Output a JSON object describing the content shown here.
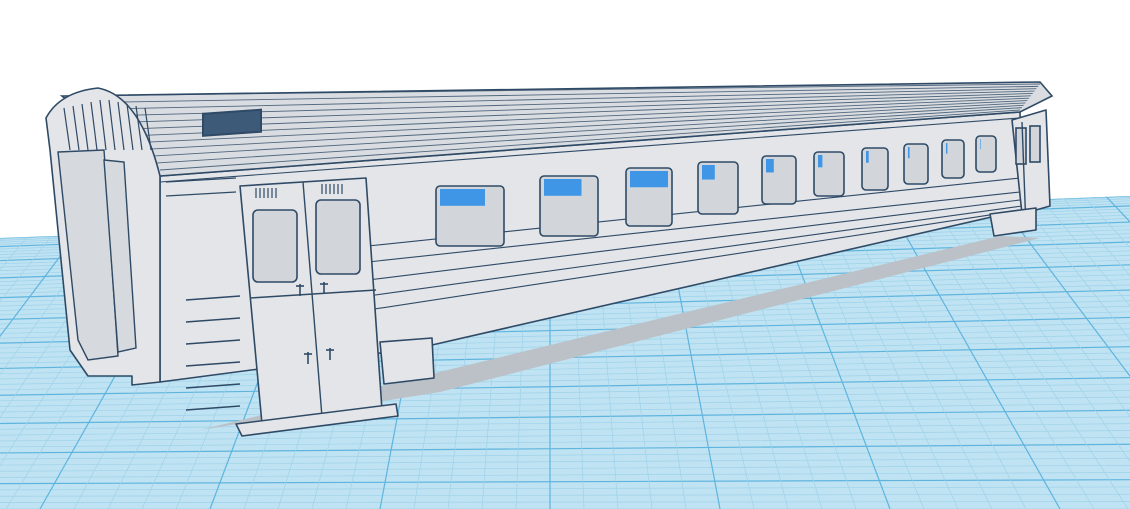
{
  "viewport": {
    "background_color": "#ffffff",
    "workplane_color": "#bfe3f2",
    "grid_minor_color": "#9fd2ea",
    "grid_major_color": "#5fb4de"
  },
  "model": {
    "kind": "passenger-railcar-shell",
    "body_color": "#e3e5e8",
    "edge_color": "#2f4a66",
    "shadow_color": "#bcc1c7",
    "window_glass_color": "#3f95e6",
    "window_count": 10,
    "door_count": 2
  }
}
